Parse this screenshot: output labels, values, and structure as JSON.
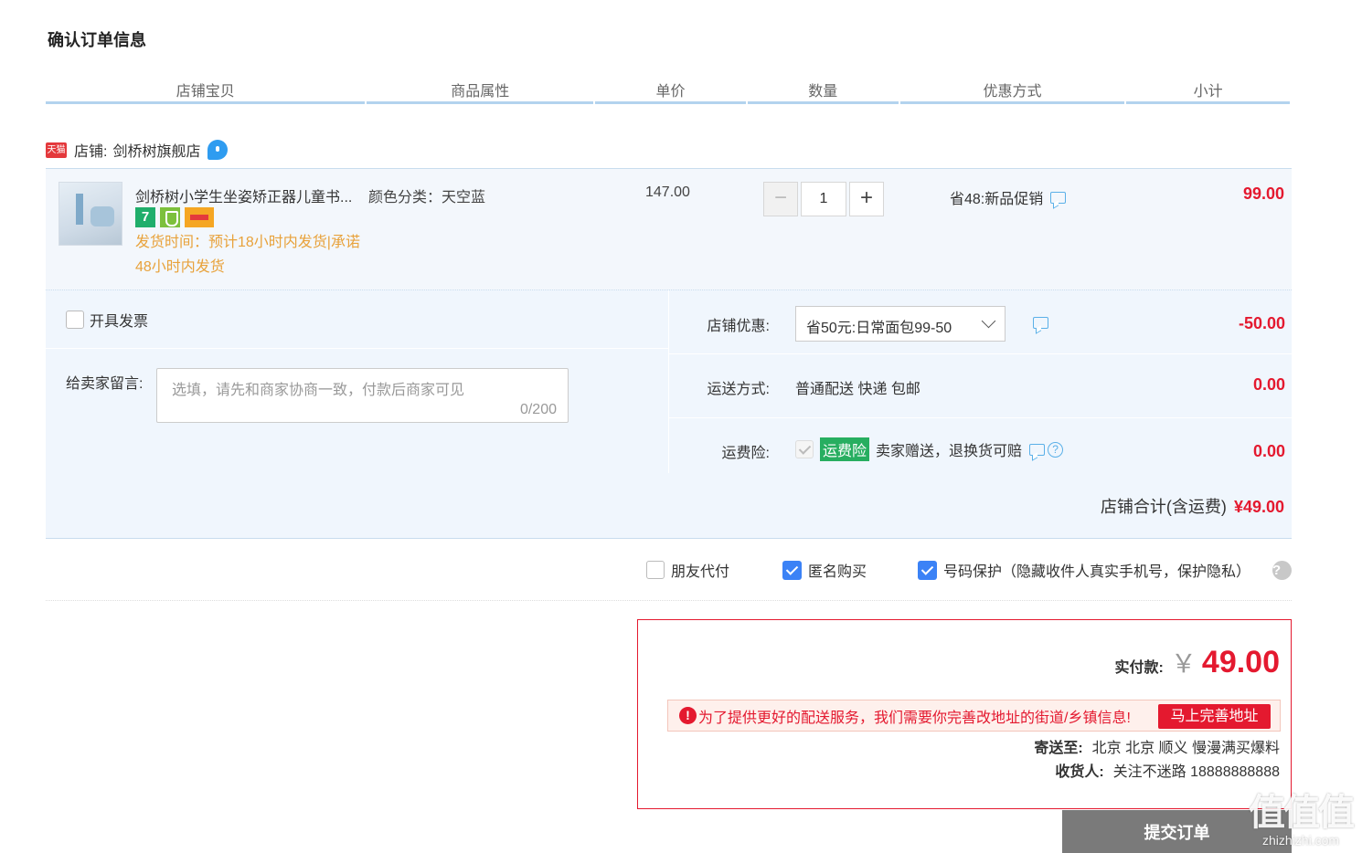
{
  "page_title": "确认订单信息",
  "columns": [
    "店铺宝贝",
    "商品属性",
    "单价",
    "数量",
    "优惠方式",
    "小计"
  ],
  "shop": {
    "badge": "天猫",
    "label": "店铺:",
    "name": "剑桥树旗舰店"
  },
  "item": {
    "name": "剑桥树小学生坐姿矫正器儿童书...",
    "badge_7": "7",
    "ship_note": "发货时间：预计18小时内发货|承诺48小时内发货",
    "attr": "颜色分类：天空蓝",
    "price": "147.00",
    "qty_minus": "−",
    "qty": "1",
    "qty_plus": "+",
    "promo": "省48:新品促销",
    "subtotal": "99.00"
  },
  "options": {
    "invoice_label": "开具发票",
    "message_label": "给卖家留言:",
    "message_placeholder": "选填，请先和商家协商一致，付款后商家可见",
    "message_count": "0/200",
    "shop_discount_label": "店铺优惠:",
    "shop_discount_value": "省50元:日常面包99-50",
    "shop_discount_amount": "-50.00",
    "shipping_label": "运送方式:",
    "shipping_value": "普通配送 快递 包邮",
    "shipping_amount": "0.00",
    "insurance_label": "运费险:",
    "insurance_tag": "运费险",
    "insurance_desc": "卖家赠送，退换货可赔",
    "insurance_help": "?",
    "insurance_amount": "0.00",
    "shop_total_label": "店铺合计(含运费)",
    "shop_total_amount": "¥49.00"
  },
  "extras": {
    "friend_pay": "朋友代付",
    "anonymous": "匿名购买",
    "number_protect": "号码保护（隐藏收件人真实手机号，保护隐私）",
    "help": "?"
  },
  "payment": {
    "label": "实付款:",
    "currency": "￥",
    "amount": "49.00",
    "warning_icon": "!",
    "warning": "为了提供更好的配送服务，我们需要你完善改地址的街道/乡镇信息!",
    "fix_button": "马上完善地址",
    "address_label": "寄送至:",
    "address": "北京 北京 顺义 慢漫满买爆料",
    "receiver_label": "收货人:",
    "receiver": "关注不迷路 18888888888"
  },
  "submit_label": "提交订单",
  "watermark": {
    "logo": "值值值",
    "site": "zhizhizhi.com"
  },
  "colors": {
    "accent_red": "#e4192f",
    "header_line": "#b3d3ee",
    "section_bg": "#f0f6fd",
    "checkbox_blue": "#3b82f6",
    "ship_note_orange": "#e8a23b",
    "insurance_green": "#27ae60"
  }
}
